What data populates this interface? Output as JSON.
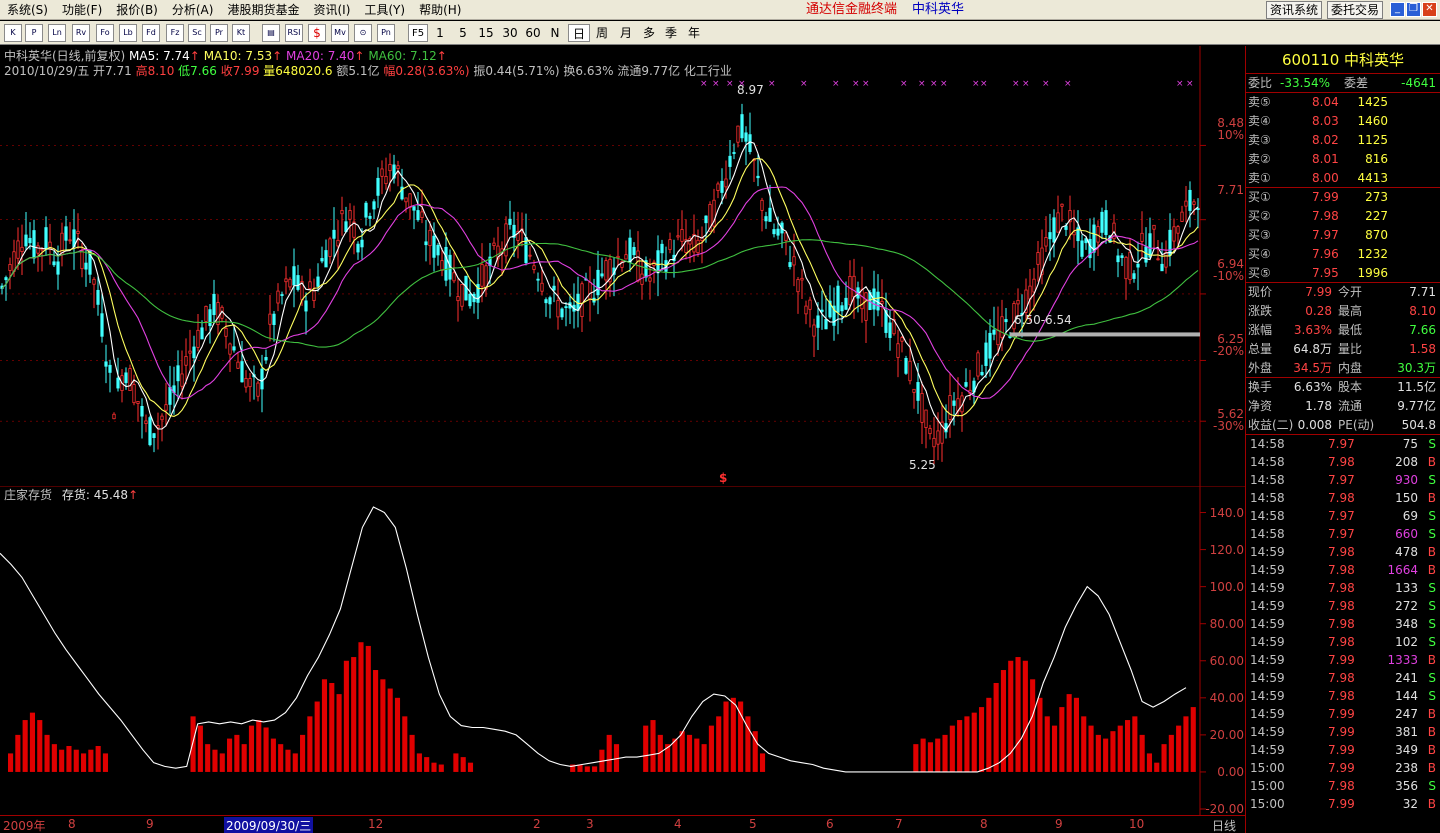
{
  "menu": [
    "系统(S)",
    "功能(F)",
    "报价(B)",
    "分析(A)",
    "港股期货基金",
    "资讯(I)",
    "工具(Y)",
    "帮助(H)"
  ],
  "app_title": "通达信金融终端",
  "app_stock": "中科英华",
  "top_buttons": [
    "资讯系统",
    "委托交易"
  ],
  "toolbar_icons": [
    "K",
    "P",
    "Ln",
    "Rv",
    "Fo",
    "Lb",
    "Fd",
    "Fz",
    "Sc",
    "Pr",
    "Kt",
    "RSI",
    "$",
    "Mv",
    "Pn"
  ],
  "periods": [
    "F5",
    "1",
    "5",
    "15",
    "30",
    "60",
    "N",
    "日",
    "周",
    "月",
    "多",
    "季",
    "年"
  ],
  "active_period": "日",
  "legend": {
    "name": "中科英华(日线,前复权)",
    "ma5": "MA5: 7.74",
    "ma10": "MA10: 7.53",
    "ma20": "MA20: 7.40",
    "ma60": "MA60: 7.12",
    "info_date": "2010/10/29/五",
    "info_open": "开7.71",
    "info_high": "高8.10",
    "info_low": "低7.66",
    "info_close": "收7.99",
    "info_vol": "量648020.6",
    "info_amt": "额5.1亿",
    "info_chg": "幅0.28(3.63%)",
    "info_amp": "振0.44(5.71%)",
    "info_turn": "换6.63%",
    "info_float": "流通9.77亿",
    "info_industry": "化工行业"
  },
  "main_yaxis": [
    "8.48",
    "7.71",
    "6.94",
    "6.25",
    "5.62"
  ],
  "main_pct": [
    "10%",
    "-10%",
    "-20%",
    "-30%"
  ],
  "annotations": {
    "high": "8.97",
    "low": "5.25",
    "band": "6.50-6.54",
    "dollar": "$"
  },
  "sub_legend": {
    "name": "庄家存货",
    "value": "存货: 45.48"
  },
  "sub_yaxis": [
    "140.0",
    "120.0",
    "100.0",
    "80.00",
    "60.00",
    "40.00",
    "20.00",
    "0.00",
    "-20.00"
  ],
  "xaxis": {
    "labels": [
      "2009年",
      "8",
      "9",
      "2009/09/30/三",
      "12",
      "2",
      "3",
      "4",
      "5",
      "6",
      "7",
      "8",
      "9",
      "10"
    ],
    "period": "日线"
  },
  "panel": {
    "title": "600110 中科英华",
    "webi_label": "委比",
    "webi": "-33.54%",
    "weicha_label": "委差",
    "weicha": "-4641",
    "asks": [
      {
        "label": "卖⑤",
        "price": "8.04",
        "vol": "1425"
      },
      {
        "label": "卖④",
        "price": "8.03",
        "vol": "1460"
      },
      {
        "label": "卖③",
        "price": "8.02",
        "vol": "1125"
      },
      {
        "label": "卖②",
        "price": "8.01",
        "vol": "816"
      },
      {
        "label": "卖①",
        "price": "8.00",
        "vol": "4413"
      }
    ],
    "bids": [
      {
        "label": "买①",
        "price": "7.99",
        "vol": "273"
      },
      {
        "label": "买②",
        "price": "7.98",
        "vol": "227"
      },
      {
        "label": "买③",
        "price": "7.97",
        "vol": "870"
      },
      {
        "label": "买④",
        "price": "7.96",
        "vol": "1232"
      },
      {
        "label": "买⑤",
        "price": "7.95",
        "vol": "1996"
      }
    ],
    "stats": [
      {
        "l1": "现价",
        "v1": "7.99",
        "c1": "red",
        "l2": "今开",
        "v2": "7.71",
        "c2": "white"
      },
      {
        "l1": "涨跌",
        "v1": "0.28",
        "c1": "red",
        "l2": "最高",
        "v2": "8.10",
        "c2": "red"
      },
      {
        "l1": "涨幅",
        "v1": "3.63%",
        "c1": "red",
        "l2": "最低",
        "v2": "7.66",
        "c2": "green"
      },
      {
        "l1": "总量",
        "v1": "64.8万",
        "c1": "white",
        "l2": "量比",
        "v2": "1.58",
        "c2": "red"
      },
      {
        "l1": "外盘",
        "v1": "34.5万",
        "c1": "red",
        "l2": "内盘",
        "v2": "30.3万",
        "c2": "green"
      }
    ],
    "fundamentals": [
      {
        "l1": "换手",
        "v1": "6.63%",
        "l2": "股本",
        "v2": "11.5亿"
      },
      {
        "l1": "净资",
        "v1": "1.78",
        "l2": "流通",
        "v2": "9.77亿"
      },
      {
        "l1": "收益(二)",
        "v1": "0.008",
        "l2": "PE(动)",
        "v2": "504.8"
      }
    ],
    "ticks": [
      {
        "time": "14:58",
        "price": "7.97",
        "vol": "75",
        "bs": "S",
        "pc": "red",
        "vc": "white"
      },
      {
        "time": "14:58",
        "price": "7.98",
        "vol": "208",
        "bs": "B",
        "pc": "red",
        "vc": "white"
      },
      {
        "time": "14:58",
        "price": "7.97",
        "vol": "930",
        "bs": "S",
        "pc": "red",
        "vc": "purple"
      },
      {
        "time": "14:58",
        "price": "7.98",
        "vol": "150",
        "bs": "B",
        "pc": "red",
        "vc": "white"
      },
      {
        "time": "14:58",
        "price": "7.97",
        "vol": "69",
        "bs": "S",
        "pc": "red",
        "vc": "white"
      },
      {
        "time": "14:58",
        "price": "7.97",
        "vol": "660",
        "bs": "S",
        "pc": "red",
        "vc": "purple"
      },
      {
        "time": "14:59",
        "price": "7.98",
        "vol": "478",
        "bs": "B",
        "pc": "red",
        "vc": "white"
      },
      {
        "time": "14:59",
        "price": "7.98",
        "vol": "1664",
        "bs": "B",
        "pc": "red",
        "vc": "purple"
      },
      {
        "time": "14:59",
        "price": "7.98",
        "vol": "133",
        "bs": "S",
        "pc": "red",
        "vc": "white"
      },
      {
        "time": "14:59",
        "price": "7.98",
        "vol": "272",
        "bs": "S",
        "pc": "red",
        "vc": "white"
      },
      {
        "time": "14:59",
        "price": "7.98",
        "vol": "348",
        "bs": "S",
        "pc": "red",
        "vc": "white"
      },
      {
        "time": "14:59",
        "price": "7.98",
        "vol": "102",
        "bs": "S",
        "pc": "red",
        "vc": "white"
      },
      {
        "time": "14:59",
        "price": "7.99",
        "vol": "1333",
        "bs": "B",
        "pc": "red",
        "vc": "purple"
      },
      {
        "time": "14:59",
        "price": "7.98",
        "vol": "241",
        "bs": "S",
        "pc": "red",
        "vc": "white"
      },
      {
        "time": "14:59",
        "price": "7.98",
        "vol": "144",
        "bs": "S",
        "pc": "red",
        "vc": "white"
      },
      {
        "time": "14:59",
        "price": "7.99",
        "vol": "247",
        "bs": "B",
        "pc": "red",
        "vc": "white"
      },
      {
        "time": "14:59",
        "price": "7.99",
        "vol": "381",
        "bs": "B",
        "pc": "red",
        "vc": "white"
      },
      {
        "time": "14:59",
        "price": "7.99",
        "vol": "349",
        "bs": "B",
        "pc": "red",
        "vc": "white"
      },
      {
        "time": "15:00",
        "price": "7.99",
        "vol": "238",
        "bs": "B",
        "pc": "red",
        "vc": "white"
      },
      {
        "time": "15:00",
        "price": "7.98",
        "vol": "356",
        "bs": "S",
        "pc": "red",
        "vc": "white"
      },
      {
        "time": "15:00",
        "price": "7.99",
        "vol": "32",
        "bs": "B",
        "pc": "red",
        "vc": "white"
      }
    ]
  },
  "colors": {
    "up": "#ff3030",
    "down": "#40ffff",
    "ma5": "#ffffff",
    "ma10": "#ffff60",
    "ma20": "#e040e0",
    "ma60": "#40c040",
    "grid": "#a00000"
  },
  "chart_data": [
    {
      "type": "candlestick",
      "title": "中科英华(日线,前复权)",
      "ylim": [
        5.0,
        9.2
      ],
      "yticks": [
        8.48,
        7.71,
        6.94,
        6.25,
        5.62
      ],
      "series": [
        {
          "name": "MA5",
          "values": [
            7.74
          ]
        },
        {
          "name": "MA10",
          "values": [
            7.53
          ]
        },
        {
          "name": "MA20",
          "values": [
            7.4
          ]
        },
        {
          "name": "MA60",
          "values": [
            7.12
          ]
        }
      ],
      "path": [
        7.0,
        7.3,
        7.6,
        7.4,
        7.5,
        7.3,
        7.6,
        7.4,
        7.2,
        6.6,
        5.8,
        6.2,
        5.9,
        5.5,
        5.6,
        5.8,
        6.1,
        6.4,
        6.6,
        6.8,
        6.6,
        6.3,
        6.0,
        5.9,
        6.6,
        6.9,
        7.1,
        6.9,
        7.0,
        7.4,
        7.6,
        7.8,
        7.5,
        7.9,
        8.1,
        8.3,
        8.0,
        7.8,
        7.5,
        7.4,
        7.2,
        7.0,
        6.9,
        7.1,
        7.3,
        7.5,
        7.6,
        7.4,
        7.2,
        6.9,
        6.8,
        6.7,
        6.9,
        7.0,
        7.2,
        7.3,
        7.4,
        7.2,
        7.1,
        7.3,
        7.4,
        7.5,
        7.4,
        7.6,
        7.9,
        8.3,
        8.7,
        8.4,
        7.9,
        7.6,
        7.5,
        7.2,
        6.8,
        6.6,
        6.7,
        6.9,
        7.0,
        6.8,
        6.9,
        6.7,
        6.5,
        6.2,
        5.9,
        5.4,
        5.5,
        5.8,
        5.9,
        6.1,
        6.3,
        6.5,
        6.6,
        6.8,
        7.0,
        7.3,
        7.6,
        7.8,
        7.5,
        7.4,
        7.6,
        7.7,
        7.3,
        7.2,
        7.4,
        7.5,
        7.3,
        7.6,
        7.8,
        7.99
      ],
      "annotations": [
        "8.97",
        "5.25",
        "6.50-6.54"
      ]
    },
    {
      "type": "bar",
      "title": "庄家存货",
      "ylim": [
        -20,
        150
      ],
      "yticks": [
        140,
        120,
        100,
        80,
        60,
        40,
        20,
        0,
        -20
      ],
      "series": [
        {
          "name": "存货",
          "last": 45.48
        },
        {
          "name": "line",
          "values": [
            118,
            112,
            105,
            95,
            85,
            75,
            66,
            58,
            50,
            42,
            35,
            28,
            20,
            12,
            5,
            3,
            2,
            3,
            26,
            27,
            26,
            27,
            26,
            28,
            27,
            28,
            32,
            40,
            52,
            62,
            74,
            88,
            110,
            132,
            143,
            140,
            132,
            110,
            85,
            62,
            42,
            30,
            25,
            24,
            24,
            23,
            22,
            20,
            15,
            10,
            6,
            4,
            3,
            4,
            5,
            6,
            7,
            8,
            8,
            9,
            10,
            14,
            20,
            30,
            38,
            42,
            41,
            36,
            25,
            15,
            10,
            8,
            6,
            5,
            4,
            2,
            1,
            0,
            0,
            0,
            0,
            0,
            0,
            0,
            0,
            0,
            0,
            0,
            0,
            0,
            2,
            5,
            10,
            18,
            30,
            48,
            62,
            78,
            90,
            100,
            95,
            85,
            70,
            55,
            38,
            35,
            38,
            42,
            45.48
          ]
        },
        {
          "name": "bars",
          "values": [
            10,
            20,
            28,
            32,
            28,
            20,
            15,
            12,
            14,
            12,
            10,
            12,
            14,
            10,
            0,
            0,
            0,
            0,
            0,
            0,
            0,
            0,
            0,
            0,
            0,
            30,
            25,
            15,
            12,
            10,
            18,
            20,
            15,
            25,
            28,
            24,
            18,
            15,
            12,
            10,
            20,
            30,
            38,
            50,
            48,
            42,
            60,
            62,
            70,
            68,
            55,
            50,
            45,
            40,
            30,
            20,
            10,
            8,
            5,
            4,
            0,
            10,
            8,
            5,
            0,
            0,
            0,
            0,
            0,
            0,
            0,
            0,
            0,
            0,
            0,
            0,
            0,
            4,
            4,
            3,
            3,
            12,
            20,
            15,
            0,
            0,
            0,
            25,
            28,
            20,
            15,
            18,
            22,
            20,
            18,
            15,
            25,
            30,
            38,
            40,
            38,
            30,
            22,
            10,
            0,
            0,
            0,
            0,
            0,
            0,
            0,
            0,
            0,
            0,
            0,
            0,
            0,
            0,
            0,
            0,
            0,
            0,
            0,
            0,
            15,
            18,
            16,
            18,
            20,
            25,
            28,
            30,
            32,
            35,
            40,
            48,
            55,
            60,
            62,
            60,
            50,
            40,
            30,
            25,
            35,
            42,
            40,
            30,
            25,
            20,
            18,
            22,
            25,
            28,
            30,
            20,
            10,
            5,
            15,
            20,
            25,
            30,
            35
          ]
        }
      ]
    }
  ]
}
